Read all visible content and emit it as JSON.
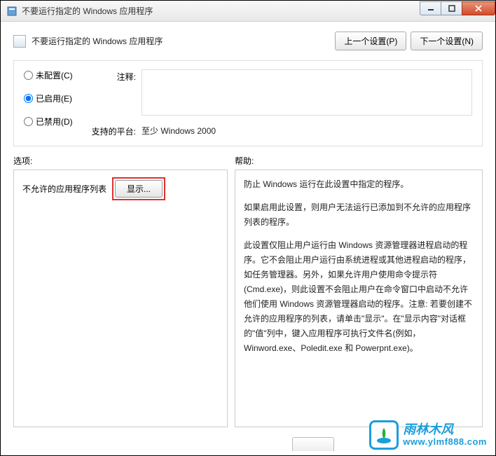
{
  "window": {
    "title": "不要运行指定的 Windows 应用程序"
  },
  "header": {
    "title": "不要运行指定的 Windows 应用程序",
    "prev_button": "上一个设置(P)",
    "next_button": "下一个设置(N)"
  },
  "config": {
    "radio_unconfigured": "未配置(C)",
    "radio_enabled": "已启用(E)",
    "radio_disabled": "已禁用(D)",
    "comment_label": "注释:",
    "platform_label": "支持的平台:",
    "platform_value": "至少 Windows 2000"
  },
  "labels": {
    "options": "选项:",
    "help": "帮助:"
  },
  "options": {
    "list_label": "不允许的应用程序列表",
    "show_button": "显示..."
  },
  "help": {
    "p1": "防止 Windows 运行在此设置中指定的程序。",
    "p2": "如果启用此设置，则用户无法运行已添加到不允许的应用程序列表的程序。",
    "p3": "此设置仅阻止用户运行由 Windows 资源管理器进程启动的程序。它不会阻止用户运行由系统进程或其他进程启动的程序，如任务管理器。另外，如果允许用户使用命令提示符(Cmd.exe)，则此设置不会阻止用户在命令窗口中启动不允许他们使用 Windows 资源管理器启动的程序。注意: 若要创建不允许的应用程序的列表，请单击\"显示\"。在\"显示内容\"对话框的\"值\"列中，键入应用程序可执行文件名(例如，Winword.exe、Poledit.exe 和 Powerpnt.exe)。"
  },
  "watermark": {
    "cn": "雨林木风",
    "url": "www.ylmf888.com"
  }
}
